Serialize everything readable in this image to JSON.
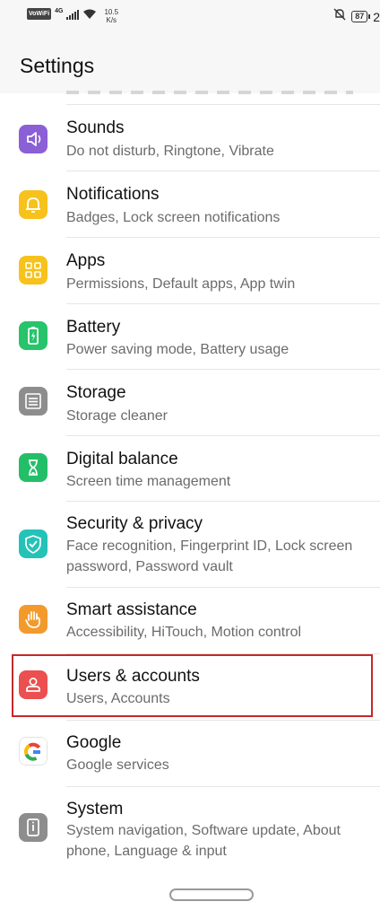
{
  "status_bar": {
    "volte": "VoWiFi",
    "network": "4G",
    "speed_value": "10.5",
    "speed_unit": "K/s",
    "battery": "87",
    "time": "2"
  },
  "header": {
    "title": "Settings"
  },
  "items": [
    {
      "title": "Sounds",
      "subtitle": "Do not disturb, Ringtone, Vibrate",
      "icon": "speaker-icon",
      "color": "#8b5fd6"
    },
    {
      "title": "Notifications",
      "subtitle": "Badges, Lock screen notifications",
      "icon": "bell-icon",
      "color": "#f6c21b"
    },
    {
      "title": "Apps",
      "subtitle": "Permissions, Default apps, App twin",
      "icon": "apps-grid-icon",
      "color": "#f6c21b"
    },
    {
      "title": "Battery",
      "subtitle": "Power saving mode, Battery usage",
      "icon": "battery-icon",
      "color": "#27c46b"
    },
    {
      "title": "Storage",
      "subtitle": "Storage cleaner",
      "icon": "storage-icon",
      "color": "#8d8d8d"
    },
    {
      "title": "Digital balance",
      "subtitle": "Screen time management",
      "icon": "hourglass-icon",
      "color": "#23bf68"
    },
    {
      "title": "Security & privacy",
      "subtitle": "Face recognition, Fingerprint ID, Lock screen password, Password vault",
      "icon": "shield-icon",
      "color": "#25c2b7"
    },
    {
      "title": "Smart assistance",
      "subtitle": "Accessibility, HiTouch, Motion control",
      "icon": "hand-icon",
      "color": "#f39a2c"
    },
    {
      "title": "Users & accounts",
      "subtitle": "Users, Accounts",
      "icon": "user-icon",
      "color": "#ec4f4f"
    },
    {
      "title": "Google",
      "subtitle": "Google services",
      "icon": "google-icon",
      "color": "#ffffff"
    },
    {
      "title": "System",
      "subtitle": "System navigation, Software update, About phone, Language & input",
      "icon": "phone-info-icon",
      "color": "#8d8d8d"
    }
  ]
}
